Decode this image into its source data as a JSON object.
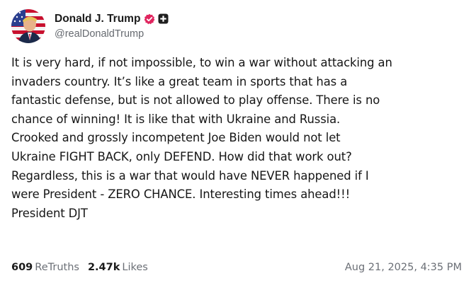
{
  "author": {
    "display_name": "Donald J. Trump",
    "handle": "@realDonaldTrump",
    "avatar_icon": "avatar-flag-portrait",
    "verified_icon": "verified-badge-icon",
    "verified_color": "#e0245e",
    "extra_icon": "plus-square-icon"
  },
  "post": {
    "lines": [
      "It is very hard, if not impossible, to win a war without attacking an",
      "invaders country. It’s like a great team in sports that has a",
      "fantastic defense, but is not allowed to play offense. There is no",
      "chance of winning! It is like that with Ukraine and Russia.",
      "Crooked and grossly incompetent Joe Biden would not let",
      "Ukraine FIGHT BACK, only DEFEND. How did that work out?",
      "Regardless, this is a war that would have NEVER happened if I",
      "were President - ZERO CHANCE. Interesting times ahead!!!",
      "President DJT"
    ]
  },
  "stats": {
    "retruths_count": "609",
    "retruths_label": "ReTruths",
    "likes_count": "2.47k",
    "likes_label": "Likes"
  },
  "timestamp": "Aug 21, 2025, 4:35 PM"
}
